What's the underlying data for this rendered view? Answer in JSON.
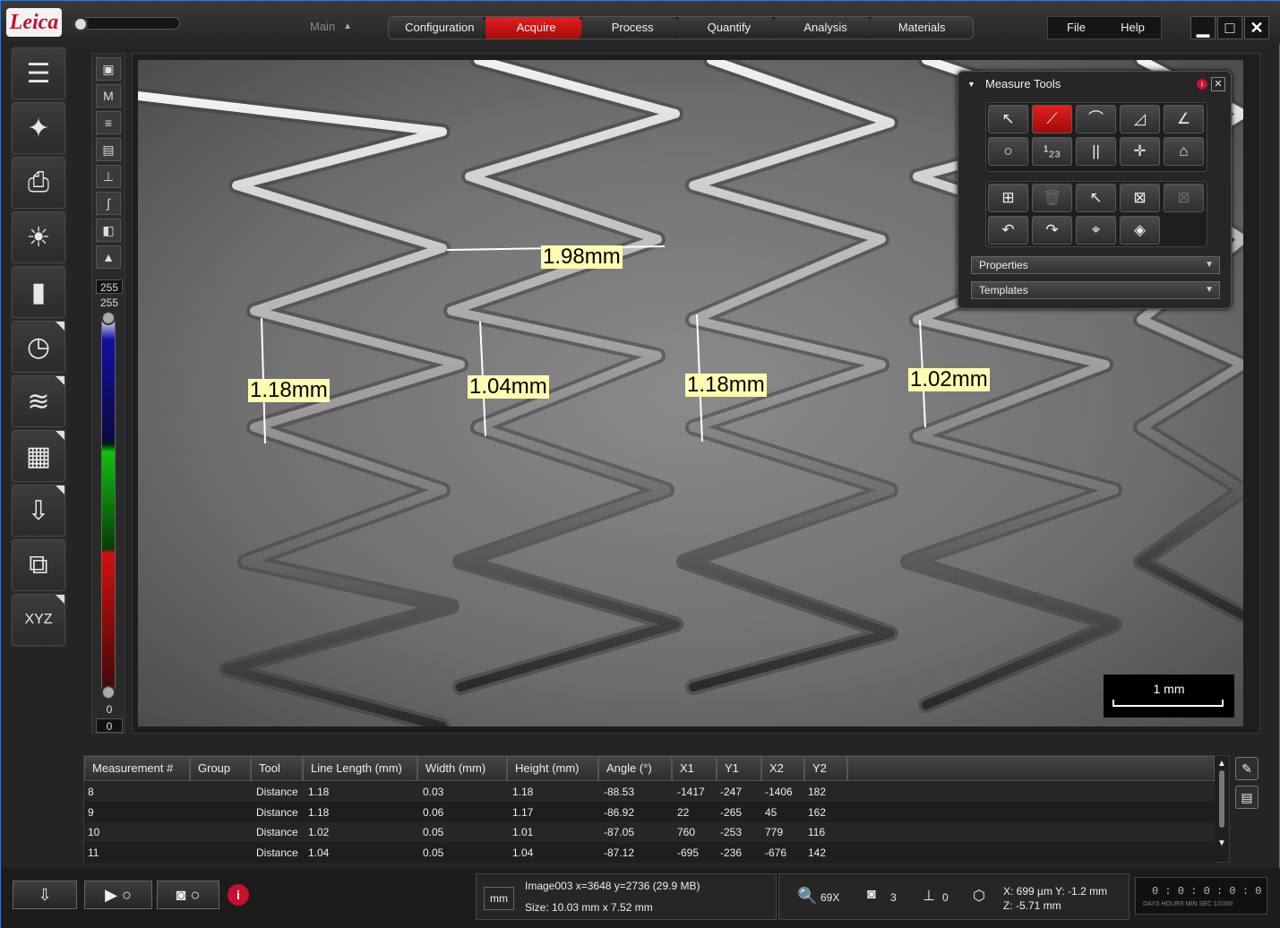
{
  "titlebar": {
    "logo": "Leica",
    "main_select": "Main",
    "workflow": [
      "Configuration",
      "Acquire",
      "Process",
      "Quantify",
      "Analysis",
      "Materials"
    ],
    "active_tab": "Acquire",
    "menu": [
      "File",
      "Help"
    ]
  },
  "colorbar": {
    "top_value": "255",
    "top_value2": "255",
    "bottom_value": "0",
    "bottom_value2": "0"
  },
  "viewer": {
    "measurements": [
      "1.98mm",
      "1.18mm",
      "1.04mm",
      "1.18mm",
      "1.02mm"
    ],
    "scalebar": "1 mm"
  },
  "measure_tools": {
    "title": "Measure Tools",
    "properties": "Properties",
    "templates": "Templates"
  },
  "table": {
    "headers": [
      "Measurement #",
      "Group",
      "Tool",
      "Line Length (mm)",
      "Width (mm)",
      "Height (mm)",
      "Angle (°)",
      "X1",
      "Y1",
      "X2",
      "Y2"
    ],
    "rows": [
      [
        "8",
        "",
        "Distance",
        "1.18",
        "0.03",
        "1.18",
        "-88.53",
        "-1417",
        "-247",
        "-1406",
        "182"
      ],
      [
        "9",
        "",
        "Distance",
        "1.18",
        "0.06",
        "1.17",
        "-86.92",
        "22",
        "-265",
        "45",
        "162"
      ],
      [
        "10",
        "",
        "Distance",
        "1.02",
        "0.05",
        "1.01",
        "-87.05",
        "760",
        "-253",
        "779",
        "116"
      ],
      [
        "11",
        "",
        "Distance",
        "1.04",
        "0.05",
        "1.04",
        "-87.12",
        "-695",
        "-236",
        "-676",
        "142"
      ]
    ]
  },
  "status": {
    "unit": "mm",
    "image_info": "Image003 x=3648 y=2736  (29.9 MB)",
    "size": "Size: 10.03 mm x 7.52 mm",
    "zoom": "69X",
    "count_a": "3",
    "count_b": "0",
    "xy": "X: 699 µm Y: -1.2 mm",
    "z": "Z: -5.71 mm",
    "clock": "0 : 0 : 0 : 0 : 0",
    "clock_labels": "DAYS  HOURS  MIN  SEC  1/1000"
  },
  "colors": {
    "accent": "#c8102e",
    "label_bg": "#fffbb0"
  }
}
